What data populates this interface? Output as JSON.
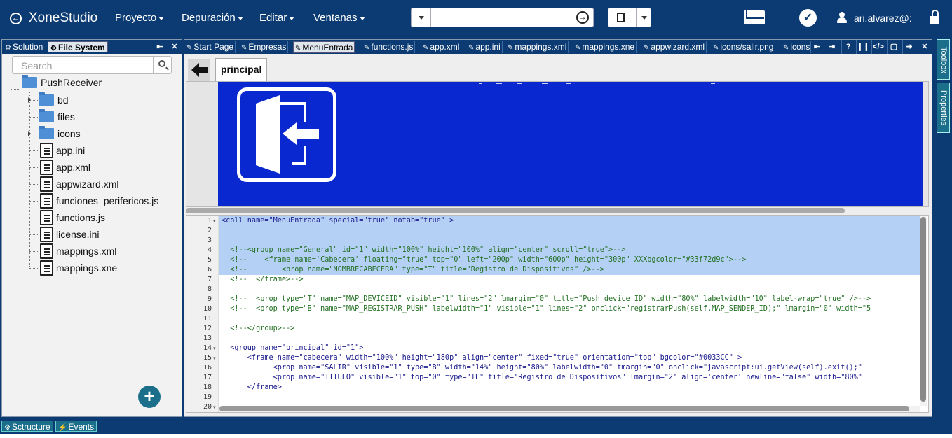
{
  "app": {
    "title": "XoneStudio"
  },
  "menu": [
    {
      "label": "Proyecto"
    },
    {
      "label": "Depuración"
    },
    {
      "label": "Editar"
    },
    {
      "label": "Ventanas"
    }
  ],
  "toolbar": {
    "search_value": ""
  },
  "user": {
    "name": "ari.alvarez@:"
  },
  "left_panel": {
    "tabs": [
      {
        "label": "Solution",
        "active": false
      },
      {
        "label": "File System",
        "active": true
      }
    ],
    "search_placeholder": "Search",
    "tree": {
      "root": "PushReceiver",
      "children": [
        {
          "label": "bd",
          "type": "folder",
          "expandable": true
        },
        {
          "label": "files",
          "type": "folder",
          "expandable": false
        },
        {
          "label": "icons",
          "type": "folder",
          "expandable": true
        },
        {
          "label": "app.ini",
          "type": "file"
        },
        {
          "label": "app.xml",
          "type": "file"
        },
        {
          "label": "appwizard.xml",
          "type": "file"
        },
        {
          "label": "funciones_perifericos.js",
          "type": "file"
        },
        {
          "label": "functions.js",
          "type": "file"
        },
        {
          "label": "license.ini",
          "type": "file"
        },
        {
          "label": "mappings.xml",
          "type": "file"
        },
        {
          "label": "mappings.xne",
          "type": "file"
        }
      ]
    }
  },
  "editor": {
    "tabs": [
      {
        "label": "Start Page",
        "active": false
      },
      {
        "label": "Empresas",
        "active": false
      },
      {
        "label": "MenuEntrada",
        "active": true
      },
      {
        "label": "functions.js",
        "active": false
      },
      {
        "label": "app.xml",
        "active": false
      },
      {
        "label": "app.ini",
        "active": false
      },
      {
        "label": "mappings.xml",
        "active": false
      },
      {
        "label": "mappings.xne",
        "active": false
      },
      {
        "label": "appwizard.xml",
        "active": false
      },
      {
        "label": "icons/salir.png",
        "active": false
      },
      {
        "label": "icons",
        "active": false
      }
    ],
    "subtab": "principal",
    "code_lines": [
      {
        "n": "1",
        "fold": true,
        "text": "<coll name=\"MenuEntrada\" special=\"true\" notab=\"true\" >",
        "comment": false,
        "selected": true
      },
      {
        "n": "2",
        "fold": false,
        "text": "",
        "comment": false,
        "selected": true
      },
      {
        "n": "3",
        "fold": false,
        "text": "",
        "comment": false,
        "selected": true
      },
      {
        "n": "4",
        "fold": false,
        "text": "  <!--<group name=\"General\" id=\"1\" width=\"100%\" height=\"100%\" align=\"center\" scroll=\"true\">-->",
        "comment": true,
        "selected": true
      },
      {
        "n": "5",
        "fold": false,
        "text": "  <!--    <frame name='Cabecera' floating=\"true\" top=\"0\" left=\"200p\" width=\"600p\" height=\"300p\" XXXbgcolor=\"#33f72d9c\">-->",
        "comment": true,
        "selected": true
      },
      {
        "n": "6",
        "fold": false,
        "text": "  <!--        <prop name=\"NOMBRECABECERA\" type=\"T\" title=\"Registro de Dispositivos\" />-->",
        "comment": true,
        "selected": true
      },
      {
        "n": "7",
        "fold": false,
        "text": "  <!--  </frame>-->",
        "comment": true,
        "selected": false
      },
      {
        "n": "8",
        "fold": false,
        "text": "",
        "comment": false,
        "selected": false
      },
      {
        "n": "9",
        "fold": false,
        "text": "  <!--  <prop type=\"T\" name=\"MAP_DEVICEID\" visible=\"1\" lines=\"2\" lmargin=\"0\" title=\"Push device ID\" width=\"80%\" labelwidth=\"10\" label-wrap=\"true\" />-->",
        "comment": true,
        "selected": false
      },
      {
        "n": "10",
        "fold": false,
        "text": "  <!--  <prop type=\"B\" name=\"MAP_REGISTRAR_PUSH\" labelwidth=\"1\" visible=\"1\" lines=\"2\" onclick=\"registrarPush(self.MAP_SENDER_ID);\" lmargin=\"0\" width=\"5",
        "comment": true,
        "selected": false
      },
      {
        "n": "11",
        "fold": false,
        "text": "",
        "comment": false,
        "selected": false
      },
      {
        "n": "12",
        "fold": false,
        "text": "  <!--</group>-->",
        "comment": true,
        "selected": false
      },
      {
        "n": "13",
        "fold": false,
        "text": "",
        "comment": false,
        "selected": false
      },
      {
        "n": "14",
        "fold": true,
        "text": "  <group name=\"principal\" id=\"1\">",
        "comment": false,
        "selected": false
      },
      {
        "n": "15",
        "fold": true,
        "text": "      <frame name=\"cabecera\" width=\"100%\" height=\"180p\" align=\"center\" fixed=\"true\" orientation=\"top\" bgcolor=\"#0033CC\" >",
        "comment": false,
        "selected": false
      },
      {
        "n": "16",
        "fold": false,
        "text": "            <prop name=\"SALIR\" visible=\"1\" type=\"B\" width=\"14%\" height=\"80%\" labelwidth=\"0\" tmargin=\"0\" onclick=\"javascript:ui.getView(self).exit();\"",
        "comment": false,
        "selected": false
      },
      {
        "n": "17",
        "fold": false,
        "text": "            <prop name=\"TITULO\" visible=\"1\" top=\"0\" type=\"TL\" title=\"Registro de Dispositivos\" lmargin=\"2\" align='center' newline=\"false\" width=\"80%\"",
        "comment": false,
        "selected": false
      },
      {
        "n": "18",
        "fold": false,
        "text": "      </frame>",
        "comment": false,
        "selected": false
      },
      {
        "n": "19",
        "fold": false,
        "text": "",
        "comment": false,
        "selected": false
      },
      {
        "n": "20",
        "fold": true,
        "text": "",
        "comment": false,
        "selected": false
      }
    ]
  },
  "right_strip": [
    {
      "label": "Toolbox"
    },
    {
      "label": "Properties"
    }
  ],
  "bottom_tabs": [
    {
      "label": "Sctructure"
    },
    {
      "label": "Events"
    }
  ],
  "colors": {
    "header_bg": "#0b3b72",
    "banner_blue": "#0a28d0",
    "selection": "#b5d0f5",
    "accent_teal": "#1b6f8a"
  }
}
